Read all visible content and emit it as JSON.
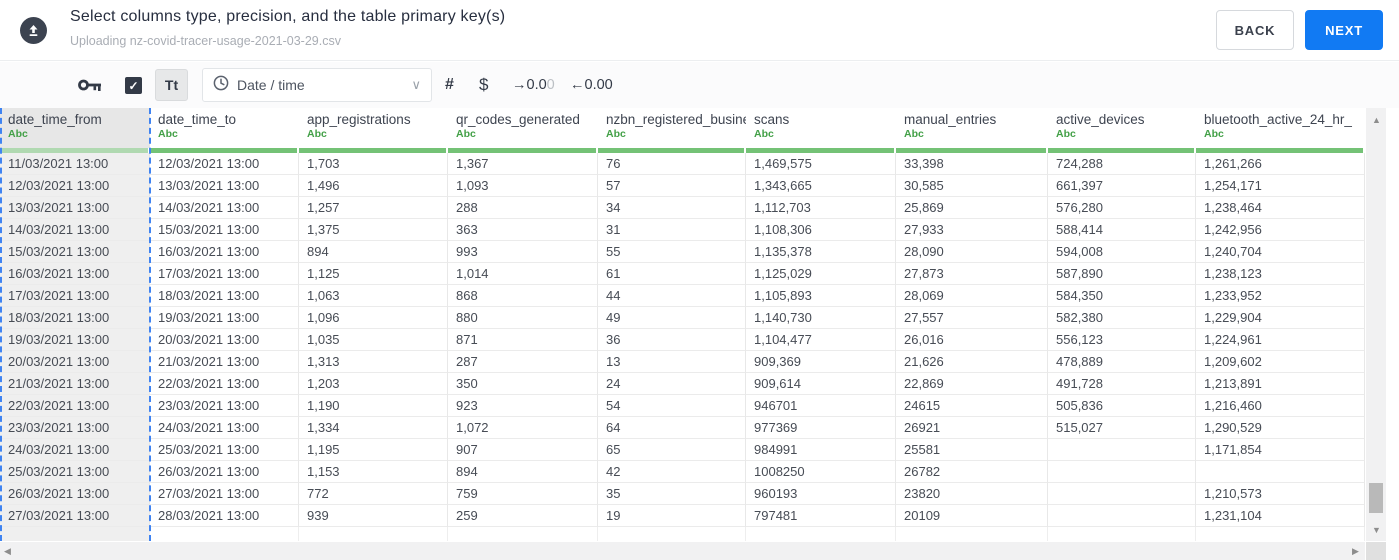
{
  "header": {
    "title": "Select columns type, precision, and the table primary key(s)",
    "subtitle": "Uploading nz-covid-tracer-usage-2021-03-29.csv",
    "back_label": "BACK",
    "next_label": "NEXT"
  },
  "toolbar": {
    "primary_key_icon": "key-icon",
    "checkbox_checked": true,
    "checkbox_glyph": "✓",
    "text_type_button_label": "Tt",
    "type_dropdown": {
      "icon": "clock-icon",
      "selected_value": "Date / time",
      "chevron": "⌄"
    },
    "number_button_label": "#",
    "currency_button_label": "$",
    "decimal_decrease": {
      "arrow": "→",
      "text": "0.0",
      "faded": "0"
    },
    "decimal_increase": {
      "arrow": "←",
      "text": "0.00"
    }
  },
  "table": {
    "columns": [
      {
        "name": "date_time_from",
        "type": "Abc",
        "selected": true
      },
      {
        "name": "date_time_to",
        "type": "Abc",
        "selected": false
      },
      {
        "name": "app_registrations",
        "type": "Abc",
        "selected": false
      },
      {
        "name": "qr_codes_generated",
        "type": "Abc",
        "selected": false
      },
      {
        "name": "nzbn_registered_busine",
        "type": "Abc",
        "selected": false
      },
      {
        "name": "scans",
        "type": "Abc",
        "selected": false
      },
      {
        "name": "manual_entries",
        "type": "Abc",
        "selected": false
      },
      {
        "name": "active_devices",
        "type": "Abc",
        "selected": false
      },
      {
        "name": "bluetooth_active_24_hr_",
        "type": "Abc",
        "selected": false
      }
    ],
    "rows": [
      [
        "11/03/2021 13:00",
        "12/03/2021 13:00",
        "1,703",
        "1,367",
        "76",
        "1,469,575",
        "33,398",
        "724,288",
        "1,261,266"
      ],
      [
        "12/03/2021 13:00",
        "13/03/2021 13:00",
        "1,496",
        "1,093",
        "57",
        "1,343,665",
        "30,585",
        "661,397",
        "1,254,171"
      ],
      [
        "13/03/2021 13:00",
        "14/03/2021 13:00",
        "1,257",
        "288",
        "34",
        "1,112,703",
        "25,869",
        "576,280",
        "1,238,464"
      ],
      [
        "14/03/2021 13:00",
        "15/03/2021 13:00",
        "1,375",
        "363",
        "31",
        "1,108,306",
        "27,933",
        "588,414",
        "1,242,956"
      ],
      [
        "15/03/2021 13:00",
        "16/03/2021 13:00",
        "894",
        "993",
        "55",
        "1,135,378",
        "28,090",
        "594,008",
        "1,240,704"
      ],
      [
        "16/03/2021 13:00",
        "17/03/2021 13:00",
        "1,125",
        "1,014",
        "61",
        "1,125,029",
        "27,873",
        "587,890",
        "1,238,123"
      ],
      [
        "17/03/2021 13:00",
        "18/03/2021 13:00",
        "1,063",
        "868",
        "44",
        "1,105,893",
        "28,069",
        "584,350",
        "1,233,952"
      ],
      [
        "18/03/2021 13:00",
        "19/03/2021 13:00",
        "1,096",
        "880",
        "49",
        "1,140,730",
        "27,557",
        "582,380",
        "1,229,904"
      ],
      [
        "19/03/2021 13:00",
        "20/03/2021 13:00",
        "1,035",
        "871",
        "36",
        "1,104,477",
        "26,016",
        "556,123",
        "1,224,961"
      ],
      [
        "20/03/2021 13:00",
        "21/03/2021 13:00",
        "1,313",
        "287",
        "13",
        "909,369",
        "21,626",
        "478,889",
        "1,209,602"
      ],
      [
        "21/03/2021 13:00",
        "22/03/2021 13:00",
        "1,203",
        "350",
        "24",
        "909,614",
        "22,869",
        "491,728",
        "1,213,891"
      ],
      [
        "22/03/2021 13:00",
        "23/03/2021 13:00",
        "1,190",
        "923",
        "54",
        "946701",
        "24615",
        "505,836",
        "1,216,460"
      ],
      [
        "23/03/2021 13:00",
        "24/03/2021 13:00",
        "1,334",
        "1,072",
        "64",
        "977369",
        "26921",
        "515,027",
        "1,290,529"
      ],
      [
        "24/03/2021 13:00",
        "25/03/2021 13:00",
        "1,195",
        "907",
        "65",
        "984991",
        "25581",
        "",
        "1,171,854"
      ],
      [
        "25/03/2021 13:00",
        "26/03/2021 13:00",
        "1,153",
        "894",
        "42",
        "1008250",
        "26782",
        "",
        ""
      ],
      [
        "26/03/2021 13:00",
        "27/03/2021 13:00",
        "772",
        "759",
        "35",
        "960193",
        "23820",
        "",
        "1,210,573"
      ],
      [
        "27/03/2021 13:00",
        "28/03/2021 13:00",
        "939",
        "259",
        "19",
        "797481",
        "20109",
        "",
        "1,231,104"
      ]
    ]
  },
  "colors": {
    "accent_blue": "#117af3",
    "selection_dashed_blue": "#3f83f1",
    "type_green": "#43a047",
    "header_underline_green": "#74c276",
    "selected_column_gray": "#efefef",
    "icon_dark": "#333a47"
  }
}
